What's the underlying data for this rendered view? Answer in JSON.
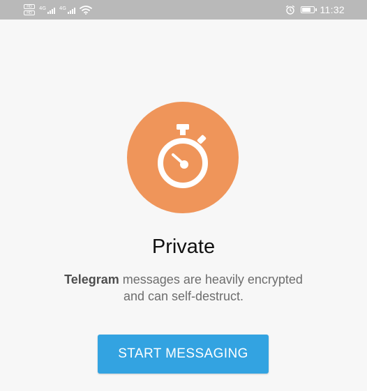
{
  "status_bar": {
    "sim1_tag": "HD",
    "sim2_tag": "HD",
    "network1": "4G",
    "network2": "4G",
    "time": "11:32",
    "icons": [
      "sim-hd-icon",
      "signal-icon",
      "signal-icon",
      "wifi-icon",
      "alarm-icon",
      "battery-icon"
    ]
  },
  "hero": {
    "icon": "stopwatch-icon",
    "circle_color": "#ef955a"
  },
  "content": {
    "title": "Private",
    "subtitle_brand": "Telegram",
    "subtitle_line1_rest": " messages are heavily encrypted",
    "subtitle_line2": "and can self-destruct."
  },
  "actions": {
    "start_label": "START MESSAGING",
    "button_color": "#33a3e1"
  }
}
